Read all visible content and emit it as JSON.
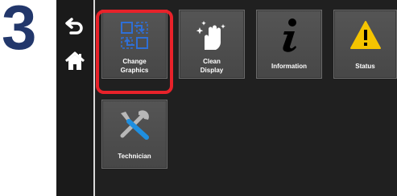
{
  "step": {
    "number": "3"
  },
  "rail": {
    "back_icon": "back-arrow-icon",
    "home_icon": "home-icon"
  },
  "tiles": [
    {
      "name": "change-graphics",
      "lines": [
        "Change",
        "Graphics"
      ],
      "icon": "change-graphics-icon",
      "selected": true
    },
    {
      "name": "clean-display",
      "lines": [
        "Clean",
        "Display"
      ],
      "icon": "clean-display-icon",
      "selected": false
    },
    {
      "name": "information",
      "lines": [
        "Information"
      ],
      "icon": "information-icon",
      "selected": false
    },
    {
      "name": "status",
      "lines": [
        "Status"
      ],
      "icon": "warning-icon",
      "selected": false
    },
    {
      "name": "technician",
      "lines": [
        "Technician"
      ],
      "icon": "tools-icon",
      "selected": false
    }
  ],
  "colors": {
    "step_number": "#22376b",
    "highlight": "#e8222a",
    "warning": "#f5c400",
    "graphics_icon": "#2f6fd6",
    "tools_icon": "#1f8fe0"
  }
}
